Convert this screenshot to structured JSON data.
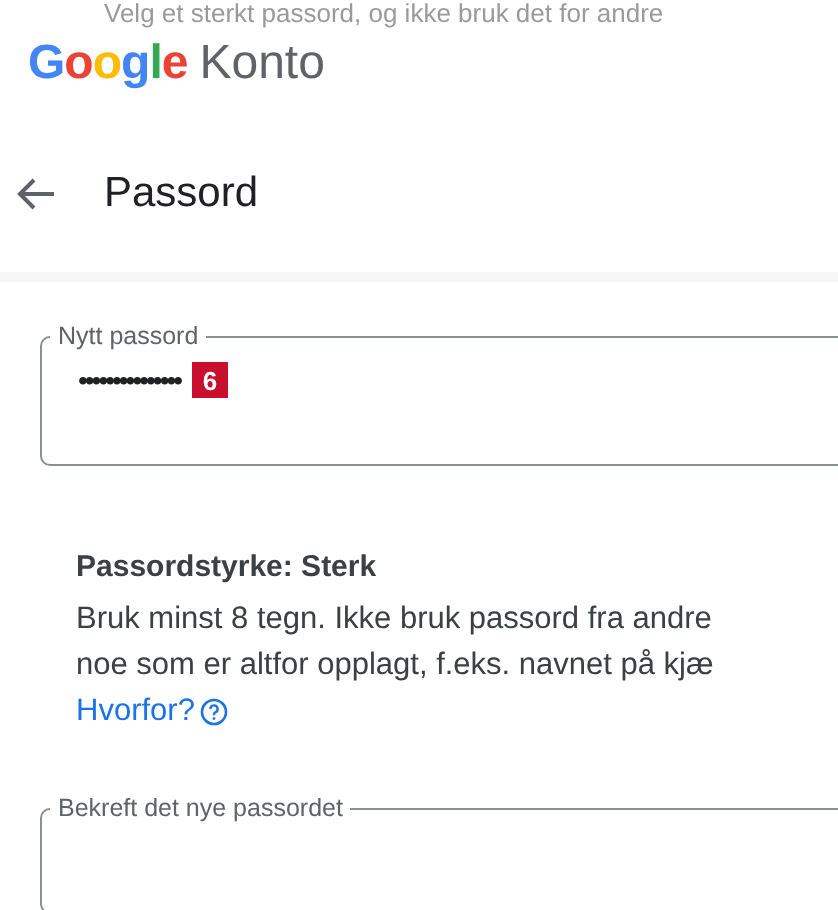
{
  "intro": "Velg et sterkt passord, og ikke bruk det for andre",
  "brand": {
    "logo": "Google",
    "product": "Konto"
  },
  "page_title": "Passord",
  "new_password": {
    "label": "Nytt passord",
    "value": "•••••••••••••••",
    "badge": "6"
  },
  "strength": "Passordstyrke: Sterk",
  "help_lines": [
    "Bruk minst 8 tegn. Ikke bruk passord fra andre",
    "noe som er altfor opplagt, f.eks. navnet på kjæ"
  ],
  "why_link": "Hvorfor?",
  "confirm_password": {
    "label": "Bekreft det nye passordet"
  }
}
